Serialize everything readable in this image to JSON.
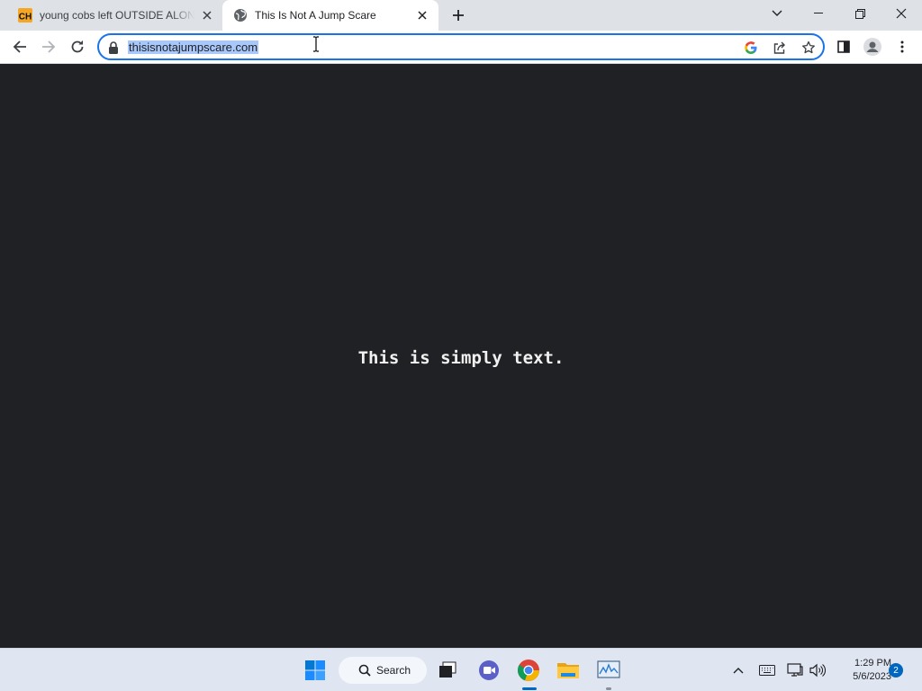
{
  "browser": {
    "tabs": [
      {
        "title": "young cobs left OUTSIDE ALONE",
        "favicon": "ch-logo-icon",
        "favicon_text": "CH",
        "active": false
      },
      {
        "title": "This Is Not A Jump Scare",
        "favicon": "globe-icon",
        "active": true
      }
    ],
    "url": "thisisnotajumpscare.com"
  },
  "page": {
    "text": "This is simply text.",
    "background": "#202124",
    "text_color": "#f1f1f1"
  },
  "taskbar": {
    "search_label": "Search",
    "pinned": [
      "windows-start-icon",
      "search-icon",
      "task-view-icon",
      "meet-chat-icon",
      "chrome-icon",
      "file-explorer-icon",
      "performance-monitor-icon"
    ],
    "time": "1:29 PM",
    "date": "5/6/2023",
    "notification_count": "2"
  },
  "colors": {
    "accent": "#1a73e8",
    "url_selection": "#a8c7fa",
    "taskbar_bg": "#dfe6f1"
  }
}
